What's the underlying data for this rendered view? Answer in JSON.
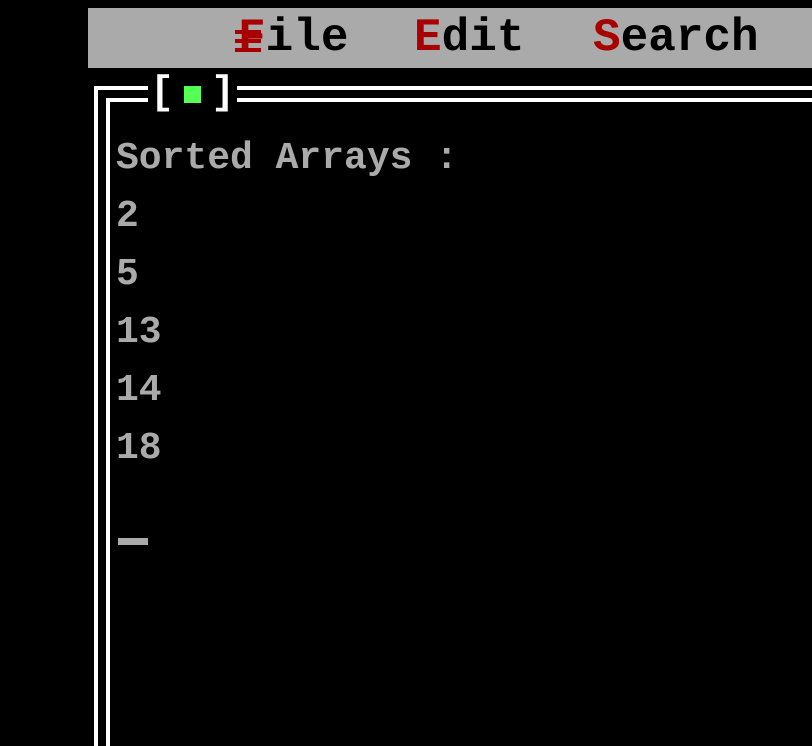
{
  "menubar": {
    "system_menu_icon": "hamburger-icon",
    "items": [
      {
        "hotkey": "F",
        "rest": "ile"
      },
      {
        "hotkey": "E",
        "rest": "dit"
      },
      {
        "hotkey": "S",
        "rest": "earch"
      }
    ]
  },
  "window": {
    "close_bracket_left": "[",
    "close_bracket_right": "]",
    "close_icon": "close-box-icon"
  },
  "output": {
    "heading": "Sorted Arrays :",
    "values": [
      "2",
      "5",
      "13",
      "14",
      "18"
    ]
  },
  "colors": {
    "menubar_bg": "#aaaaaa",
    "hotkey": "#a80000",
    "text": "#aaaaaa",
    "close_square": "#55ff55",
    "frame": "#ffffff"
  }
}
